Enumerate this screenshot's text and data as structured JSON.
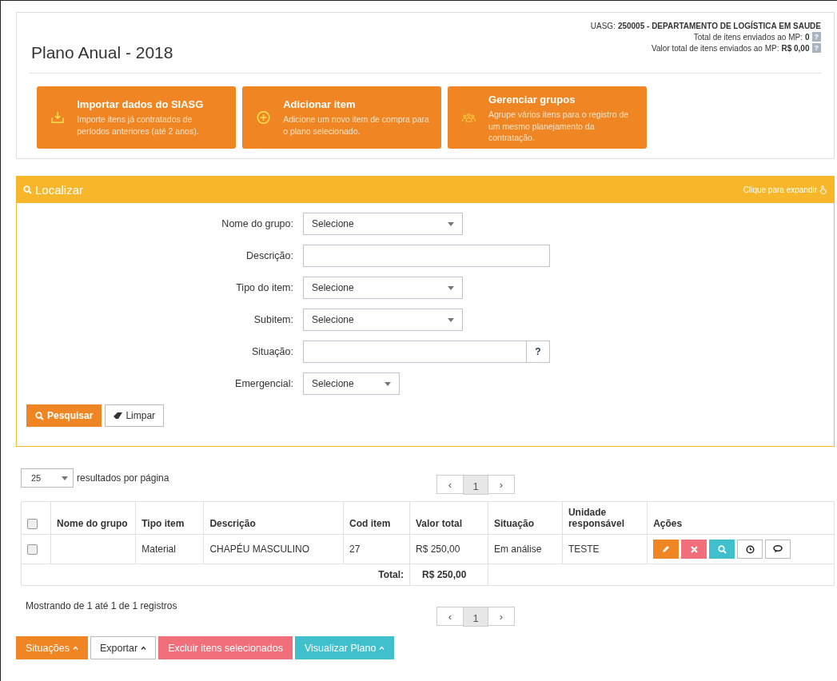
{
  "header": {
    "title": "Plano Anual - 2018",
    "uasg_label": "UASG:",
    "uasg_value": "250005 - DEPARTAMENTO DE LOGÍSTICA EM SAUDE",
    "stats": [
      {
        "label": "Total de itens enviados ao MP:",
        "value": "0",
        "help": "?"
      },
      {
        "label": "Valor total de itens enviados ao MP:",
        "value": "R$ 0,00",
        "help": "?"
      }
    ]
  },
  "actions": [
    {
      "kind": "import",
      "title": "Importar dados do SIASG",
      "text": "Importe itens já contratados de períodos anteriores (até 2 anos)."
    },
    {
      "kind": "add",
      "title": "Adicionar item",
      "text": "Adicione um novo item de compra para o plano selecionado."
    },
    {
      "kind": "groups",
      "title": "Gerenciar grupos",
      "text": "Agrupe  vários itens para o registro de um mesmo planejamento da contratação."
    }
  ],
  "search": {
    "title": "Localizar",
    "expand": "Clique para expandir",
    "fields": [
      {
        "kind": "select",
        "label": "Nome do grupo:",
        "value": "Selecione"
      },
      {
        "kind": "text",
        "label": "Descrição:"
      },
      {
        "kind": "select",
        "label": "Tipo do item:",
        "value": "Selecione"
      },
      {
        "kind": "select",
        "label": "Subitem:",
        "value": "Selecione"
      },
      {
        "kind": "text_help",
        "label": "Situação:",
        "help": "?"
      },
      {
        "kind": "select_short",
        "label": "Emergencial:",
        "value": "Selecione"
      }
    ],
    "buttons": [
      {
        "kind": "search",
        "label": "Pesquisar"
      },
      {
        "kind": "clear",
        "label": "Limpar"
      }
    ]
  },
  "page_size": {
    "value": "25",
    "label": "resultados por página"
  },
  "pagination_top": [
    {
      "label": "‹",
      "selected": false
    },
    {
      "label": "1",
      "selected": true
    },
    {
      "label": "›",
      "selected": false
    }
  ],
  "table": {
    "select_all_checked": false,
    "columns": [
      "Nome do grupo",
      "Tipo item",
      "Descrição",
      "Cod item",
      "Valor total",
      "Situação",
      "Unidade responsável",
      "Ações"
    ],
    "rows": [
      {
        "checked": false,
        "cells": [
          "",
          "Material",
          "CHAPÉU MASCULINO",
          "27",
          "R$ 250,00",
          "Em análise",
          "TESTE"
        ],
        "actions": [
          {
            "kind": "edit"
          },
          {
            "kind": "delete"
          },
          {
            "kind": "view"
          },
          {
            "kind": "history"
          },
          {
            "kind": "comment"
          }
        ]
      }
    ],
    "total_label": "Total:",
    "total_value": "R$ 250,00"
  },
  "info": "Mostrando de 1 até 1 de 1 registros",
  "pagination_bottom": [
    {
      "label": "‹",
      "selected": false
    },
    {
      "label": "1",
      "selected": true
    },
    {
      "label": "›",
      "selected": false
    }
  ],
  "footer_buttons": [
    {
      "kind": "primary",
      "label": "Situações",
      "dropdown": true
    },
    {
      "kind": "default",
      "label": "Exportar",
      "dropdown": true
    },
    {
      "kind": "danger",
      "label": "Excluir itens selecionados",
      "dropdown": false
    },
    {
      "kind": "info",
      "label": "Visualizar Plano",
      "dropdown": true
    }
  ]
}
